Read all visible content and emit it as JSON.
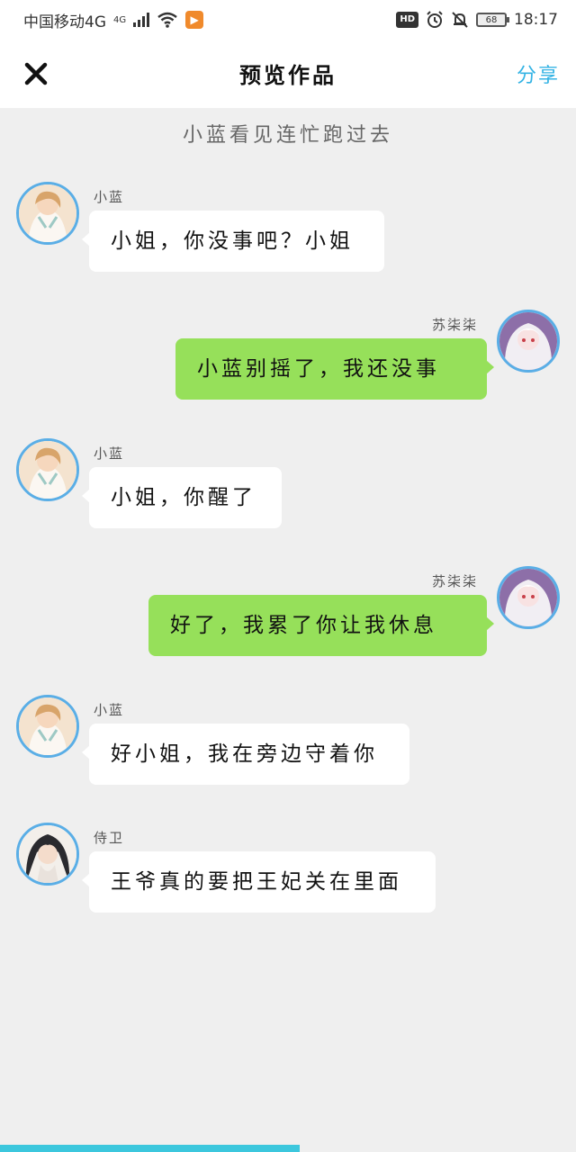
{
  "status_bar": {
    "carrier": "中国移动4G",
    "network_small": "4G",
    "time": "18:17",
    "battery": "68",
    "hd": "HD"
  },
  "header": {
    "title": "预览作品",
    "share_label": "分享",
    "close_icon": "close-icon"
  },
  "narration": "小蓝看见连忙跑过去",
  "messages": [
    {
      "sender": "小蓝",
      "text": "小姐，你没事吧？小姐",
      "side": "left"
    },
    {
      "sender": "苏柒柒",
      "text": "小蓝别摇了，我还没事",
      "side": "right"
    },
    {
      "sender": "小蓝",
      "text": "小姐，你醒了",
      "side": "left"
    },
    {
      "sender": "苏柒柒",
      "text": "好了，我累了你让我休息",
      "side": "right"
    },
    {
      "sender": "小蓝",
      "text": "好小姐，我在旁边守着你",
      "side": "left"
    },
    {
      "sender": "侍卫",
      "text": "王爷真的要把王妃关在里面",
      "side": "left"
    }
  ],
  "colors": {
    "accent": "#34b3e4",
    "bubble_green": "#96e05a",
    "avatar_ring": "#5aaee6",
    "progress": "#3cc7dd"
  },
  "progress": 0.52
}
